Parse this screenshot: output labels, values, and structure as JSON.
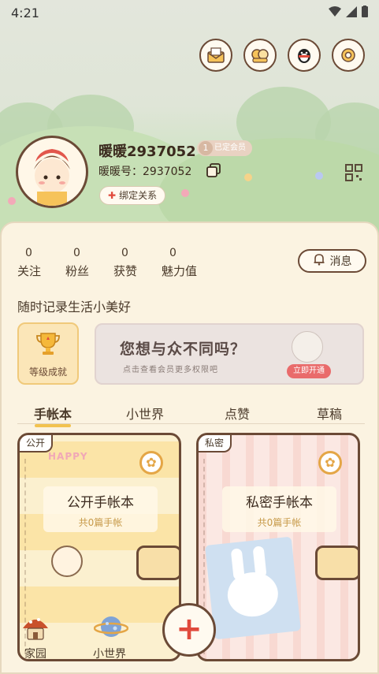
{
  "status_bar": {
    "time": "4:21"
  },
  "top_icons": [
    "mail-icon",
    "avatars-icon",
    "penguin-icon",
    "settings-icon"
  ],
  "profile": {
    "nickname": "暖暖2937052",
    "vip_badge_num": "1",
    "vip_badge_text": "已定会员",
    "uid_label": "暖暖号：2937052",
    "bind_label": "绑定关系"
  },
  "stats": [
    {
      "value": "0",
      "label": "关注"
    },
    {
      "value": "0",
      "label": "粉丝"
    },
    {
      "value": "0",
      "label": "获赞"
    },
    {
      "value": "0",
      "label": "魅力值"
    }
  ],
  "message_button": "消息",
  "motto": "随时记录生活小美好",
  "achievement_label": "等级成就",
  "banner": {
    "title": "您想与众不同吗？",
    "subtitle": "点击查看会员更多权限吧",
    "open_button": "立即开通"
  },
  "tabs": [
    "手帐本",
    "小世界",
    "点赞",
    "草稿"
  ],
  "active_tab": "手帐本",
  "notebooks": [
    {
      "tag": "公开",
      "name": "公开手帐本",
      "count": "共0篇手帐",
      "deco": "HAPPY"
    },
    {
      "tag": "私密",
      "name": "私密手帐本",
      "count": "共0篇手帐"
    }
  ],
  "bottom_nav": {
    "home": "家园",
    "world": "小世界"
  },
  "colors": {
    "accent": "#e04a3c",
    "border": "#6b4a36",
    "tab_underline": "#f2c24f"
  }
}
